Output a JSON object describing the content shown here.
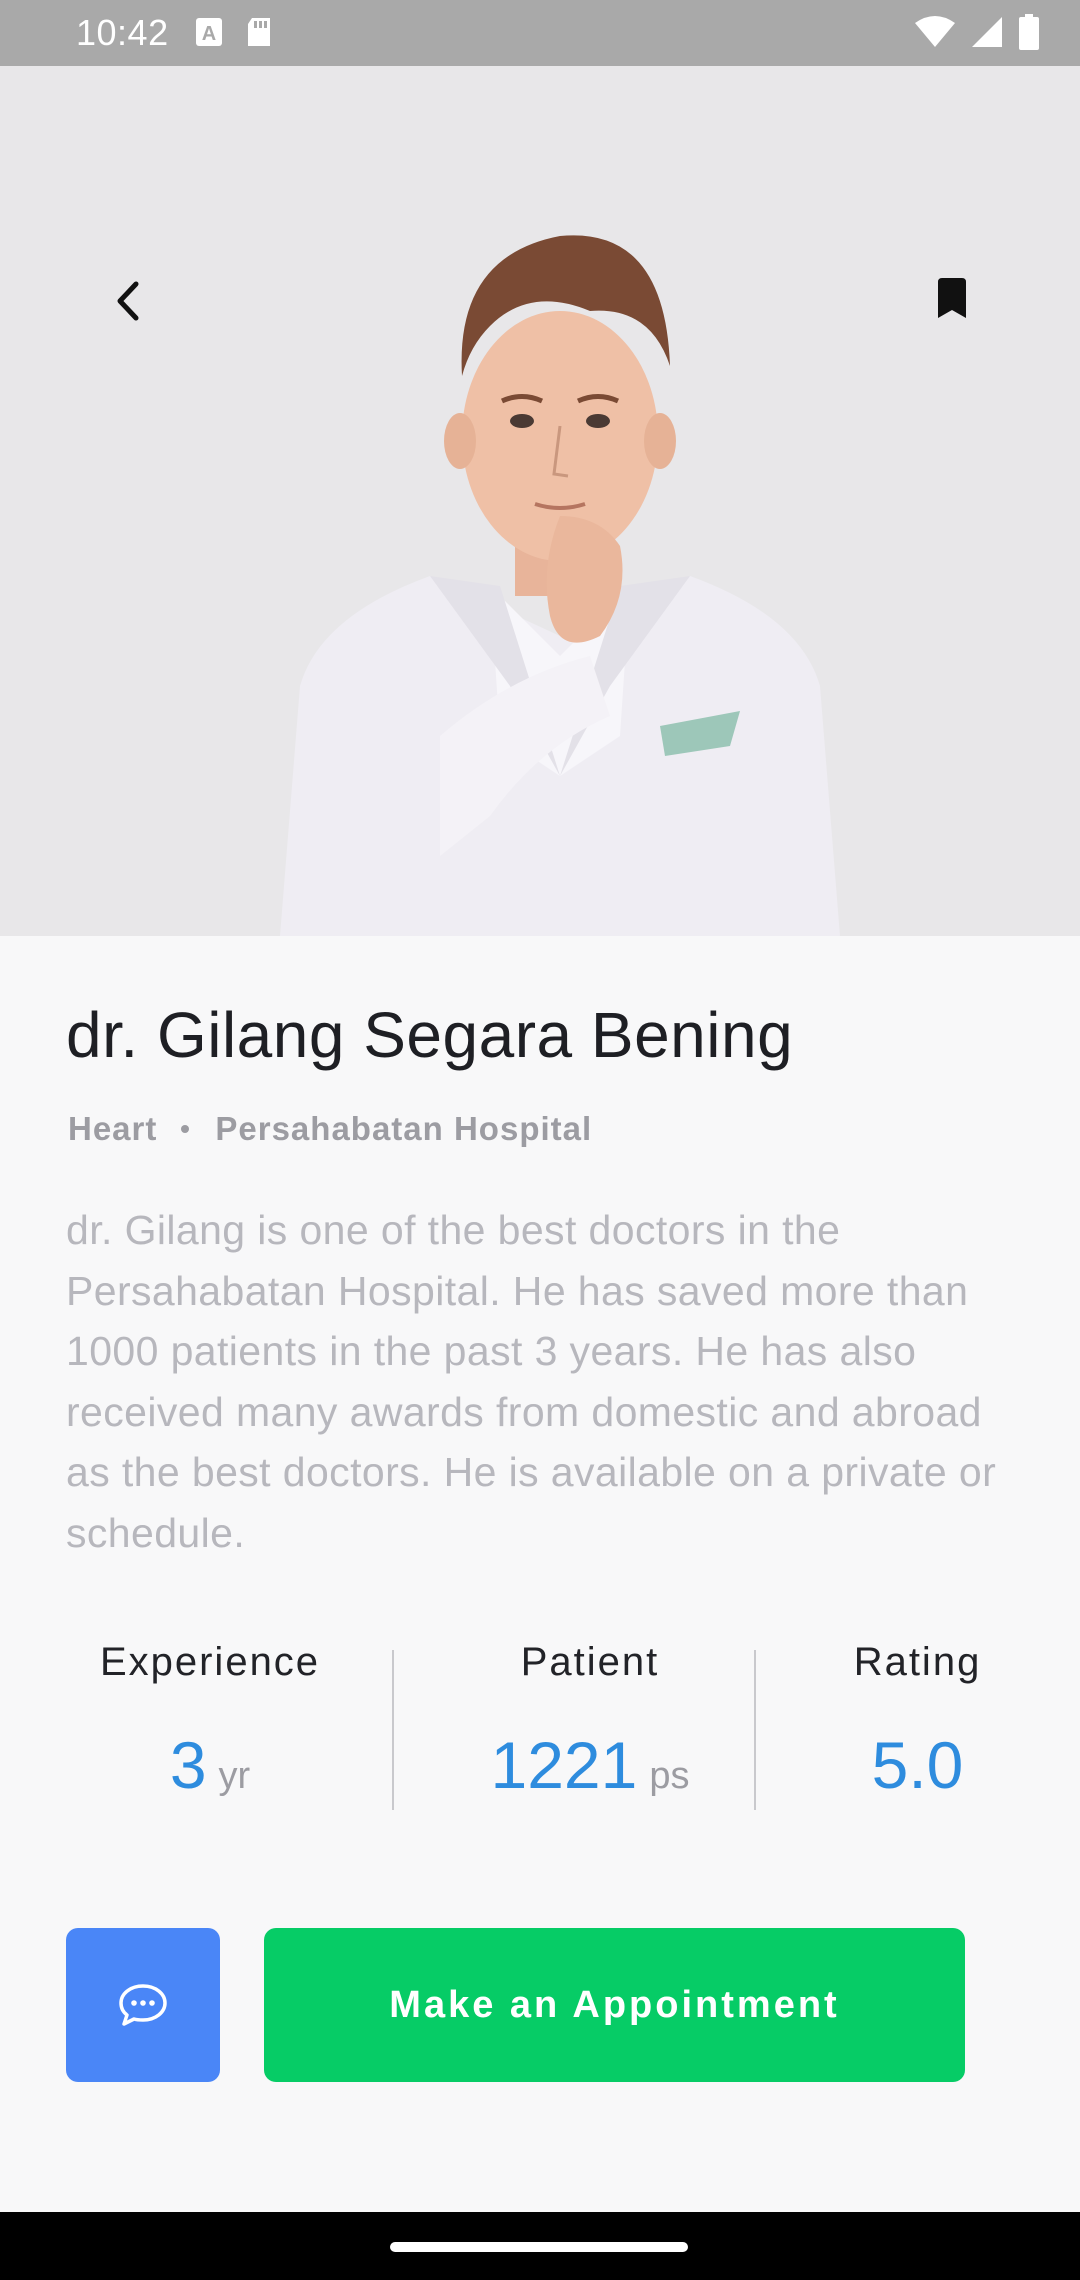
{
  "status_bar": {
    "time": "10:42",
    "left_icons": [
      "font-download-icon",
      "sd-card-icon"
    ],
    "right_icons": [
      "wifi-icon",
      "signal-icon",
      "battery-icon"
    ]
  },
  "hero": {
    "back_icon": "chevron-left-icon",
    "bookmark_icon": "bookmark-icon",
    "background_color": "#e8e7e9"
  },
  "doctor": {
    "name": "dr. Gilang Segara Bening",
    "specialty": "Heart",
    "hospital": "Persahabatan Hospital",
    "bio": "dr. Gilang is one of the best doctors in the Persahabatan Hospital. He has saved more than 1000 patients in the past 3 years. He has also received many awards from domestic and abroad as the best doctors. He is available on a private or schedule."
  },
  "stats": {
    "experience": {
      "label": "Experience",
      "value": "3",
      "unit": "yr"
    },
    "patient": {
      "label": "Patient",
      "value": "1221",
      "unit": "ps"
    },
    "rating": {
      "label": "Rating",
      "value": "5.0"
    }
  },
  "actions": {
    "chat_icon": "chat-bubble-icon",
    "appointment_label": "Make an Appointment"
  },
  "colors": {
    "accent_blue": "#2e8cde",
    "chat_button": "#4a86f7",
    "appointment_button": "#06cc66"
  }
}
